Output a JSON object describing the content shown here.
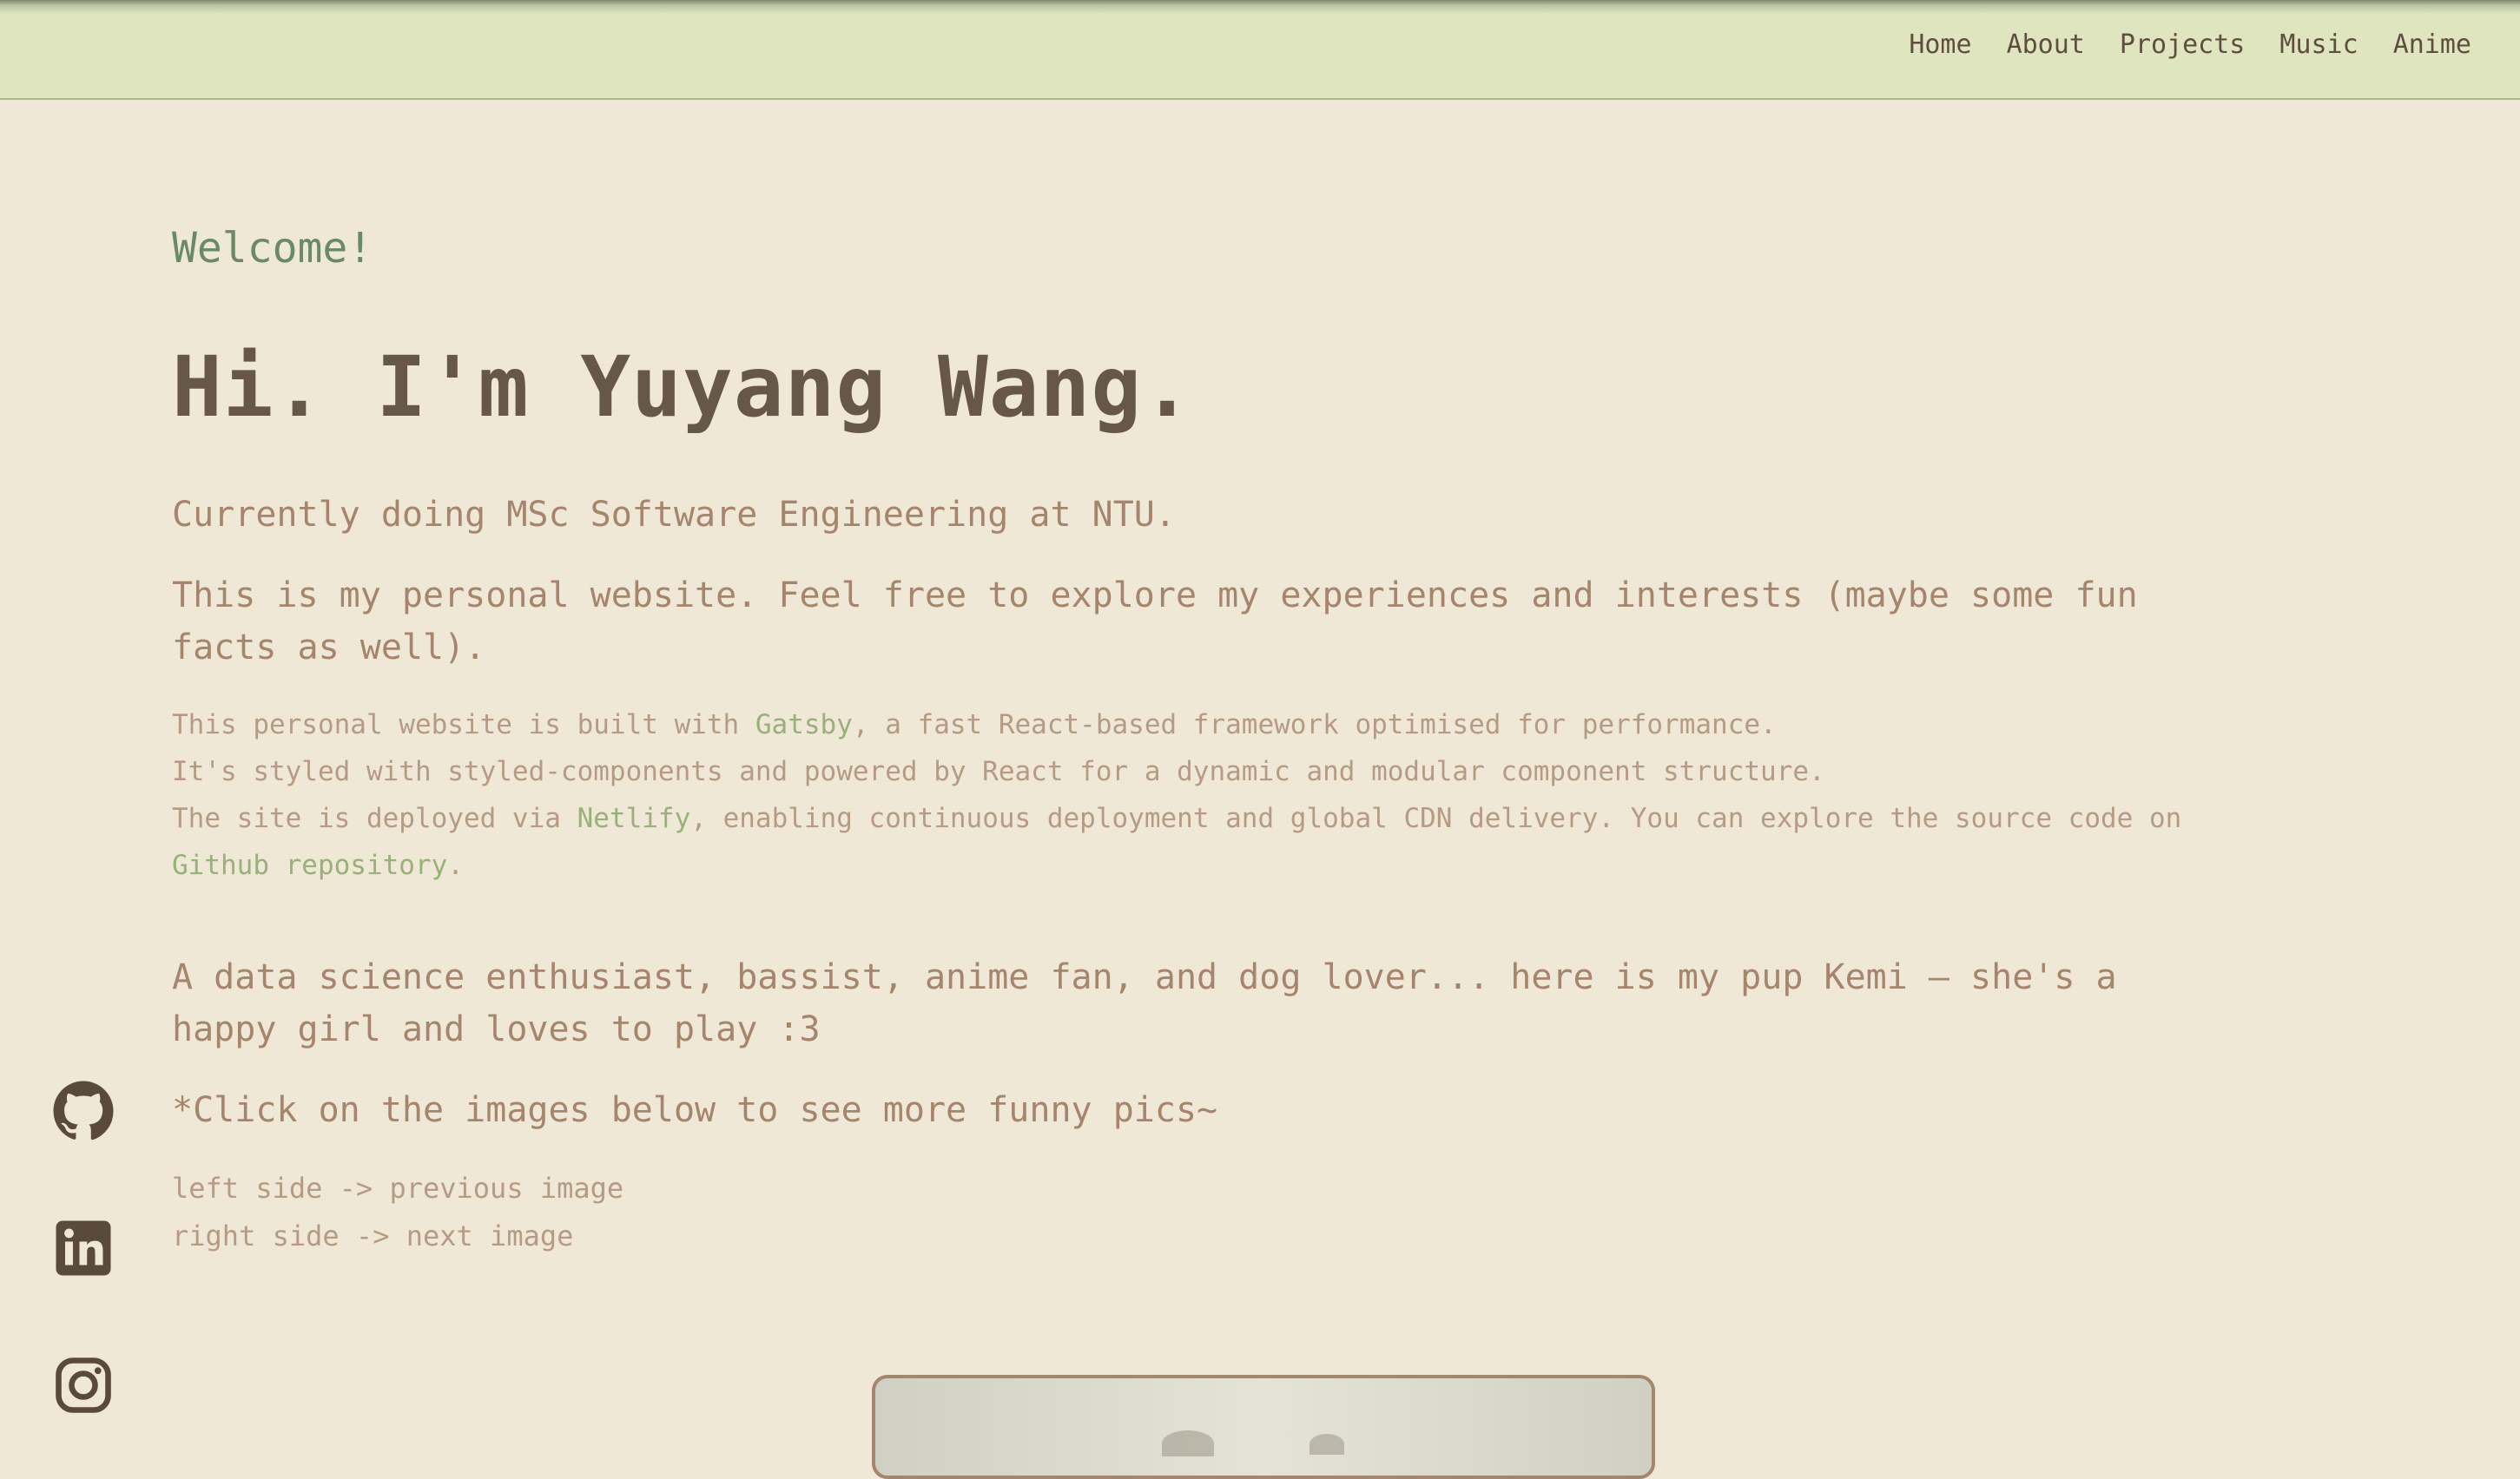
{
  "nav": {
    "items": [
      "Home",
      "About",
      "Projects",
      "Music",
      "Anime"
    ]
  },
  "hero": {
    "welcome": "Welcome!",
    "title": "Hi. I'm Yuyang Wang.",
    "subtitle": "Currently doing MSc Software Engineering at NTU.",
    "intro": "This is my personal website. Feel free to explore my experiences and interests (maybe some fun facts as well)."
  },
  "tech": {
    "line1_pre": "This personal website is built with ",
    "line1_link": "Gatsby",
    "line1_post": ", a fast React-based framework optimised for performance.",
    "line2": "It's styled with styled-components and powered by React for a dynamic and modular component structure.",
    "line3_pre": "The site is deployed via ",
    "line3_link": "Netlify",
    "line3_mid": ", enabling continuous deployment and global CDN delivery. You can explore the source code on ",
    "line3_link2": "Github repository",
    "line3_post": "."
  },
  "about": {
    "hobbies": "A data science enthusiast, bassist, anime fan, and dog lover... here is my pup Kemi — she's a happy girl and loves to play :3",
    "click_hint": "*Click on the images below to see more funny pics~",
    "left_hint": "left side -> previous image",
    "right_hint": "right side -> next image"
  },
  "social": {
    "icons": [
      "github-icon",
      "linkedin-icon",
      "instagram-icon"
    ]
  },
  "colors": {
    "background": "#efe8d6",
    "navbar": "#dfe5bf",
    "accent_green": "#6a8a65",
    "link_green": "#98b07a",
    "title": "#66574a",
    "text": "#a5856c"
  }
}
